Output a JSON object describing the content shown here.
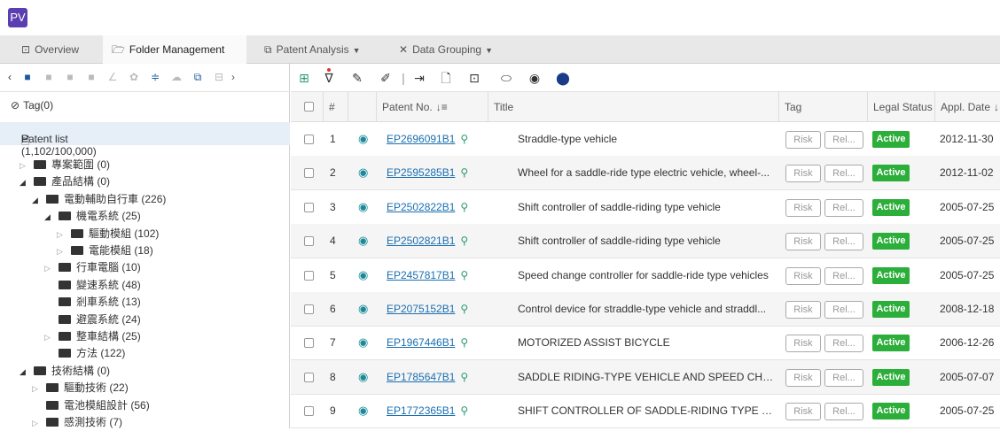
{
  "app": {
    "logo_text": "PV"
  },
  "tabs": [
    {
      "label": "Overview",
      "icon": "overview-icon",
      "glyph": "⊡"
    },
    {
      "label": "Folder Management",
      "icon": "folder-icon",
      "glyph": "🗁"
    },
    {
      "label": "Patent Analysis",
      "icon": "analysis-icon",
      "glyph": "⧉",
      "caret": "▼"
    },
    {
      "label": "Data Grouping",
      "icon": "grouping-icon",
      "glyph": "✕",
      "caret": "▼"
    }
  ],
  "left": {
    "tag_label": "Tag",
    "tag_count": "(0)",
    "patent_list_label": "Patent list (1,102/100,000)",
    "tree": [
      {
        "label": "專案範圍",
        "count": "(0)",
        "level": 0,
        "arrow": "▷"
      },
      {
        "label": "產品結構",
        "count": "(0)",
        "level": 0,
        "arrow": "◢"
      },
      {
        "label": "電動輔助自行車",
        "count": "(226)",
        "level": 1,
        "arrow": "◢"
      },
      {
        "label": "機電系統",
        "count": "(25)",
        "level": 2,
        "arrow": "◢"
      },
      {
        "label": "驅動模組",
        "count": "(102)",
        "level": 3,
        "arrow": "▷"
      },
      {
        "label": "電能模組",
        "count": "(18)",
        "level": 3,
        "arrow": "▷"
      },
      {
        "label": "行車電腦",
        "count": "(10)",
        "level": 2,
        "arrow": "▷"
      },
      {
        "label": "變速系統",
        "count": "(48)",
        "level": 2,
        "arrow": ""
      },
      {
        "label": "剎車系統",
        "count": "(13)",
        "level": 2,
        "arrow": ""
      },
      {
        "label": "避震系統",
        "count": "(24)",
        "level": 2,
        "arrow": ""
      },
      {
        "label": "整車結構",
        "count": "(25)",
        "level": 2,
        "arrow": "▷"
      },
      {
        "label": "方法",
        "count": "(122)",
        "level": 2,
        "arrow": ""
      },
      {
        "label": "技術結構",
        "count": "(0)",
        "level": 0,
        "arrow": "◢"
      },
      {
        "label": "驅動技術",
        "count": "(22)",
        "level": 1,
        "arrow": "▷"
      },
      {
        "label": "電池模組設計",
        "count": "(56)",
        "level": 1,
        "arrow": ""
      },
      {
        "label": "感測技術",
        "count": "(7)",
        "level": 1,
        "arrow": "▷"
      }
    ]
  },
  "table": {
    "headers": {
      "num": "#",
      "patent_no": "Patent No.",
      "title": "Title",
      "tag": "Tag",
      "legal_status": "Legal Status",
      "appl_date": "Appl. Date"
    },
    "tag_risk": "Risk",
    "tag_rel": "Rel...",
    "rows": [
      {
        "n": "1",
        "patent": "EP2696091B1",
        "title": "Straddle-type vehicle",
        "status": "Active",
        "date": "2012-11-30"
      },
      {
        "n": "2",
        "patent": "EP2595285B1",
        "title": "Wheel for a saddle-ride type electric vehicle, wheel-...",
        "status": "Active",
        "date": "2012-11-02"
      },
      {
        "n": "3",
        "patent": "EP2502822B1",
        "title": "Shift controller of saddle-riding type vehicle",
        "status": "Active",
        "date": "2005-07-25"
      },
      {
        "n": "4",
        "patent": "EP2502821B1",
        "title": "Shift controller of saddle-riding type vehicle",
        "status": "Active",
        "date": "2005-07-25"
      },
      {
        "n": "5",
        "patent": "EP2457817B1",
        "title": "Speed change controller for saddle-ride type vehicles",
        "status": "Active",
        "date": "2005-07-25"
      },
      {
        "n": "6",
        "patent": "EP2075152B1",
        "title": "Control device for straddle-type vehicle and straddl...",
        "status": "Active",
        "date": "2008-12-18"
      },
      {
        "n": "7",
        "patent": "EP1967446B1",
        "title": "MOTORIZED ASSIST BICYCLE",
        "status": "Active",
        "date": "2006-12-26"
      },
      {
        "n": "8",
        "patent": "EP1785647B1",
        "title": "SADDLE RIDING-TYPE VEHICLE AND SPEED CHA...",
        "status": "Active",
        "date": "2005-07-07"
      },
      {
        "n": "9",
        "patent": "EP1772365B1",
        "title": "SHIFT CONTROLLER OF SADDLE-RIDING TYPE V...",
        "status": "Active",
        "date": "2005-07-25"
      }
    ]
  },
  "colors": {
    "accent": "#5a3fb0",
    "link": "#1a6fb0",
    "active": "#2cae3a",
    "selected_row": "#e6eef8"
  }
}
